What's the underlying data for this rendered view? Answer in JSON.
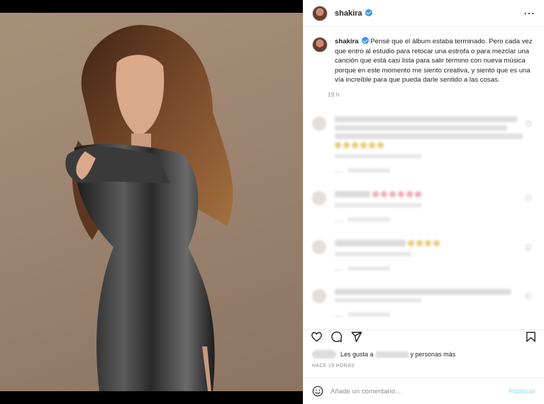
{
  "post": {
    "username": "shakira",
    "caption": "Pensé que el álbum estaba terminado. Pero cada vez que entro al estudio para retocar una estrofa o para mezclar una canción que está casi lista para salir termino con nueva música porque en este momento me siento creativa, y siento que es una vía increíble para que pueda darle sentido a las cosas.",
    "caption_time": "19 h",
    "more_icon": "⋯"
  },
  "likes": {
    "prefix": "Les gusta a",
    "suffix": "y personas más"
  },
  "post_time": "HACE 19 HORAS",
  "comment_box": {
    "placeholder": "Añade un comentario...",
    "publish_label": "Publicar"
  },
  "icons": {
    "like": "heart-icon",
    "comment": "comment-icon",
    "share": "share-icon",
    "save": "bookmark-icon",
    "emoji": "emoji-icon",
    "verified": "verified-badge-icon"
  },
  "colors": {
    "verified": "#3897f0",
    "publish_disabled": "#b2dffc",
    "photo_background": "#a89079"
  }
}
